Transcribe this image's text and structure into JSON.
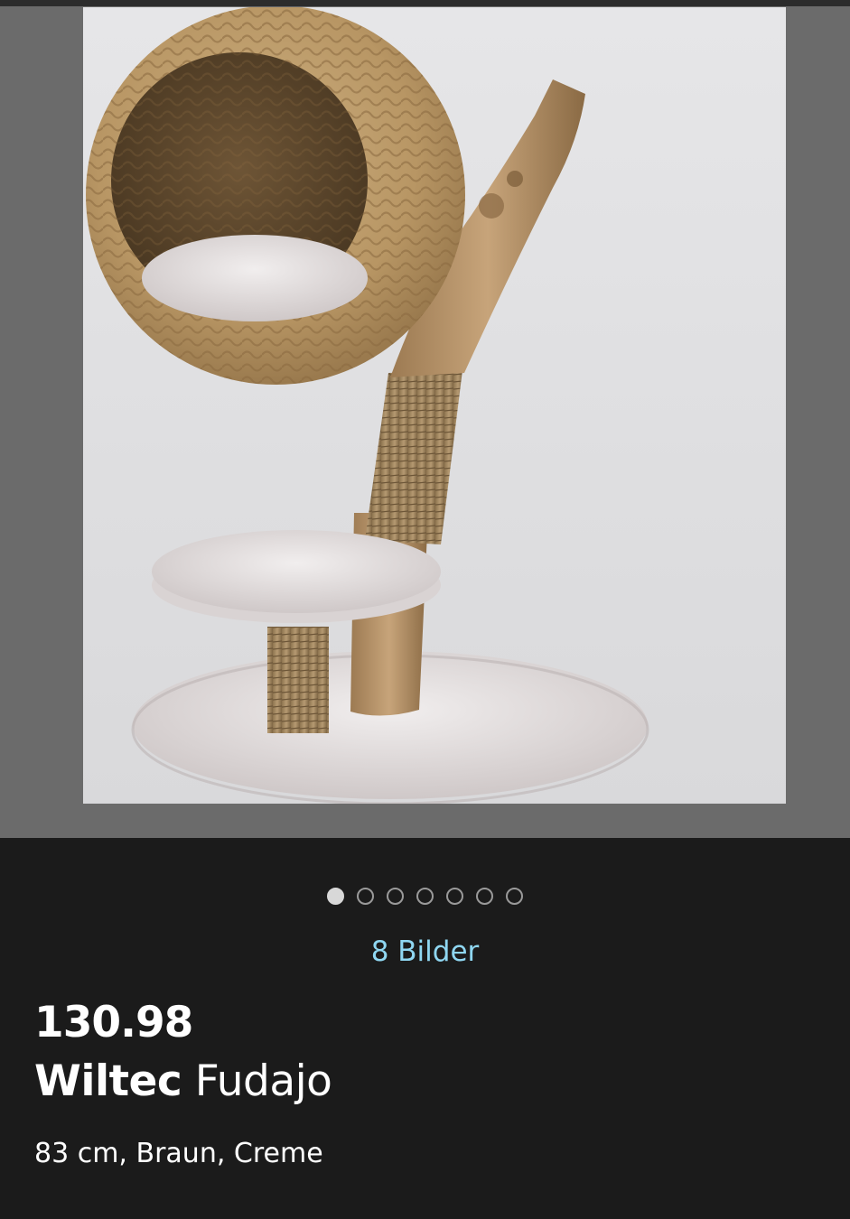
{
  "gallery": {
    "image_alt": "Wiltec Fudajo",
    "total_images": 8,
    "active_index": 0,
    "image_count_label": "8 Bilder"
  },
  "product": {
    "price": "130.98",
    "brand": "Wiltec",
    "model": "Fudajo",
    "specs": "83 cm, Braun, Creme"
  },
  "colors": {
    "background": "#1b1b1b",
    "gallery_background": "#6b6b6b",
    "link": "#8fd7f2",
    "text": "#ffffff"
  }
}
